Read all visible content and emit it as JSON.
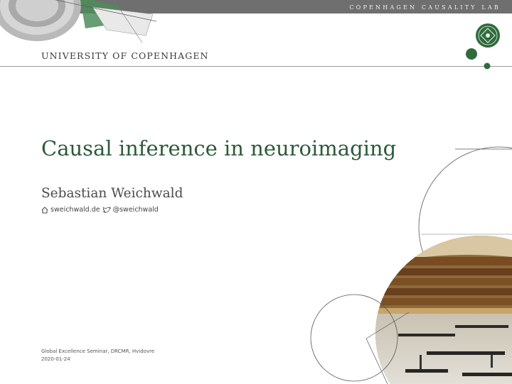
{
  "header": {
    "lab_name": "copenhagen causality lab",
    "university": "UNIVERSITY OF COPENHAGEN"
  },
  "title": "Causal inference in neuroimaging",
  "author": {
    "name": "Sebastian Weichwald",
    "website": "sweichwald.de",
    "twitter": "@sweichwald"
  },
  "footer": {
    "event": "Global Excellence Seminar, DRCMR, Hvidovre",
    "date": "2020-01-24"
  },
  "colors": {
    "topbar": "#6f6f6f",
    "accent_green": "#2c5a3a",
    "logo_green": "#2f6b3d"
  },
  "icons": {
    "website": "home-icon",
    "twitter": "twitter-bird-icon"
  }
}
